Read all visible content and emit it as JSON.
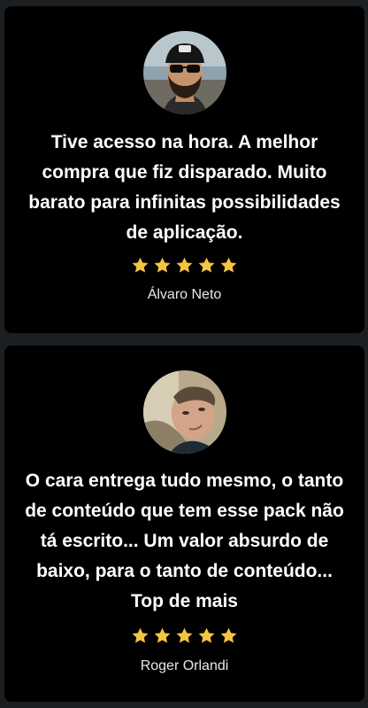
{
  "testimonials": [
    {
      "quote": "Tive acesso na hora. A melhor compra que fiz disparado. Muito barato para infinitas possibilidades de aplicação.",
      "rating": 5,
      "author": "Álvaro Neto"
    },
    {
      "quote": "O cara entrega tudo mesmo, o tanto de conteúdo que tem esse pack não tá escrito... Um valor absurdo de baixo, para o tanto de conteúdo... Top de mais",
      "rating": 5,
      "author": "Roger Orlandi"
    }
  ],
  "colors": {
    "page_bg": "#1b1f22",
    "card_bg": "#000000",
    "star": "#f5c542"
  },
  "icons": {
    "star": "star-icon"
  }
}
